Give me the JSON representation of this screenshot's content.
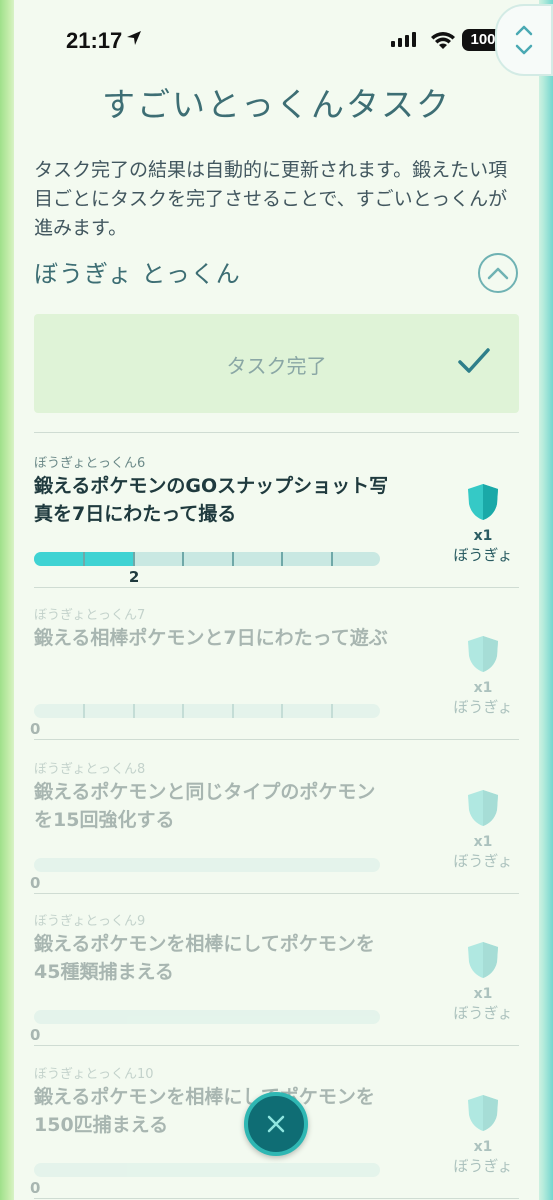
{
  "status_bar": {
    "time": "21:17",
    "battery": "100"
  },
  "title": "すごいとっくんタスク",
  "description": "タスク完了の結果は自動的に更新されます。鍛えたい項目ごとにタスクを完了させることで、すごいとっくんが進みます。",
  "section": {
    "name": "ぼうぎょ とっくん"
  },
  "completed": {
    "label": "タスク完了"
  },
  "tasks": [
    {
      "sub": "ぼうぎょとっくん6",
      "name": "鍛えるポケモンのGOスナップショット写真を7日にわたって撮る",
      "progress": 2,
      "goal": 7,
      "value_label": "2",
      "reward_count": "x1",
      "reward_name": "ぼうぎょ"
    },
    {
      "sub": "ぼうぎょとっくん7",
      "name": "鍛える相棒ポケモンと7日にわたって遊ぶ",
      "progress": 0,
      "goal": 7,
      "value_label": "0",
      "reward_count": "x1",
      "reward_name": "ぼうぎょ"
    },
    {
      "sub": "ぼうぎょとっくん8",
      "name": "鍛えるポケモンと同じタイプのポケモンを15回強化する",
      "progress": 0,
      "goal": 15,
      "value_label": "0",
      "reward_count": "x1",
      "reward_name": "ぼうぎょ"
    },
    {
      "sub": "ぼうぎょとっくん9",
      "name": "鍛えるポケモンを相棒にしてポケモンを45種類捕まえる",
      "progress": 0,
      "goal": 45,
      "value_label": "0",
      "reward_count": "x1",
      "reward_name": "ぼうぎょ"
    },
    {
      "sub": "ぼうぎょとっくん10",
      "name": "鍛えるポケモンを相棒にしてポケモンを150匹捕まえる",
      "progress": 0,
      "goal": 150,
      "value_label": "0",
      "reward_count": "x1",
      "reward_name": "ぼうぎょ"
    }
  ],
  "colors": {
    "accent": "#3fd3d3",
    "title": "#3d6e74",
    "fab": "#0f6d74"
  }
}
